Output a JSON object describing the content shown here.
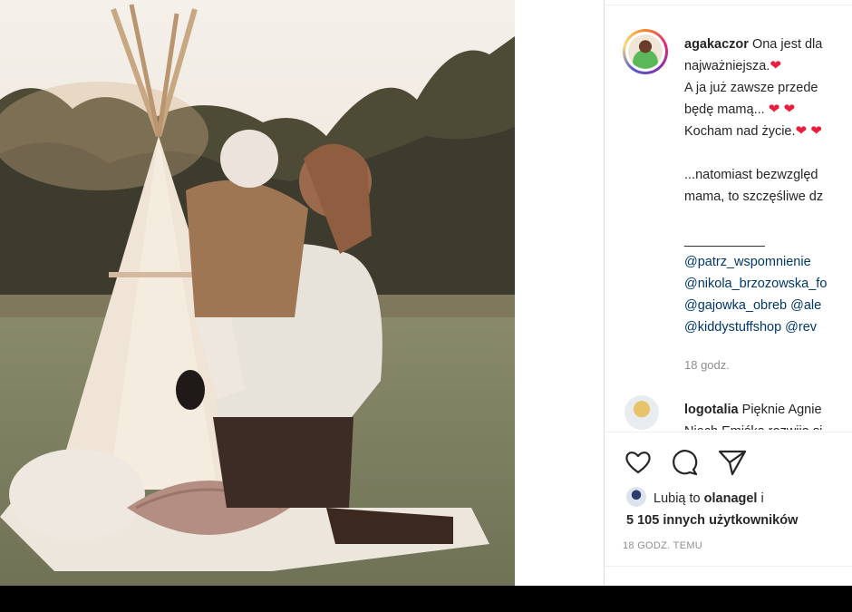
{
  "post": {
    "username": "agakaczor",
    "caption_lines": [
      "Ona jest dla",
      "najważniejsza.",
      "A ja już zawsze przede",
      "będę mamą...",
      "Kocham nad życie."
    ],
    "caption_line2": "...natomiast bezwzględ",
    "caption_line3": "mama, to szczęśliwe dz",
    "separator": "___________",
    "mentions": [
      "@patrz_wspomnienie",
      "@nikola_brzozowska_fo",
      "@gajowka_obreb @ale",
      "@kiddystuffshop @rev"
    ],
    "caption_time": "18 godz."
  },
  "comment": {
    "username": "logotalia",
    "text": "Pięknie Agnie",
    "text2": "Niech Emiśka rozwija si"
  },
  "likes": {
    "prefix": "Lubią to",
    "user": "olanagel",
    "suffix": "i",
    "count_text": "5 105 innych użytkowników"
  },
  "timestamp": "18 GODZ. TEMU",
  "icons": {
    "like": "heart-outline-icon",
    "comment": "comment-bubble-icon",
    "share": "paper-plane-icon"
  },
  "colors": {
    "link": "#00376b",
    "heart": "#ed1c3a",
    "muted": "#8e8e8e"
  }
}
